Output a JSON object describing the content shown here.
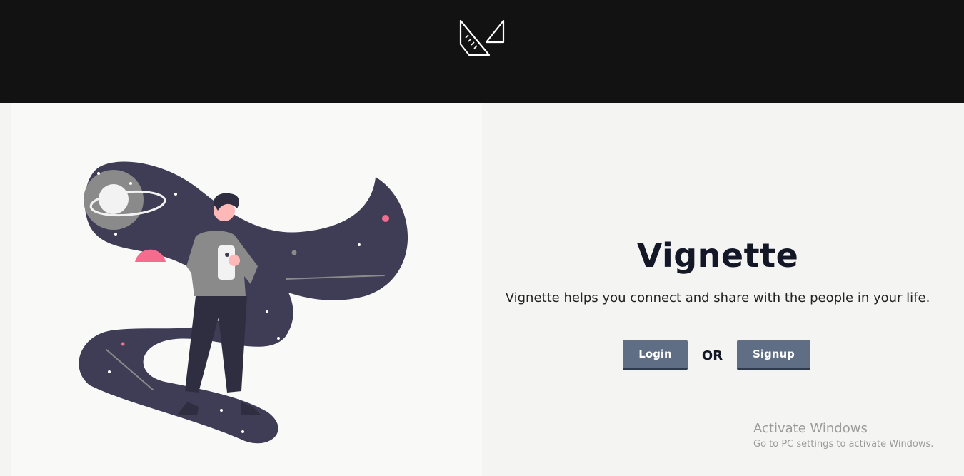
{
  "header": {
    "logo_icon": "brand-logo-icon"
  },
  "hero": {
    "title": "Vignette",
    "tagline": "Vignette helps you connect and share with the people in your life.",
    "login_label": "Login",
    "or_label": "OR",
    "signup_label": "Signup"
  },
  "watermark": {
    "title": "Activate Windows",
    "subtitle": "Go to PC settings to activate Windows."
  },
  "colors": {
    "header_bg": "#121212",
    "button_bg": "#5f6d85",
    "button_border": "#2f3a4c",
    "title_color": "#141726",
    "space_ribbon": "#3f3d56",
    "accent_pink": "#f26d8e"
  }
}
